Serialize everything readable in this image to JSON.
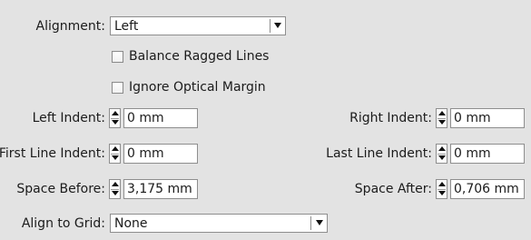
{
  "alignment": {
    "label": "Alignment:",
    "value": "Left"
  },
  "checkboxes": {
    "balance_ragged_lines": {
      "label": "Balance Ragged Lines",
      "checked": false
    },
    "ignore_optical_margin": {
      "label": "Ignore Optical Margin",
      "checked": false
    }
  },
  "left_indent": {
    "label": "Left Indent:",
    "value": "0 mm"
  },
  "right_indent": {
    "label": "Right Indent:",
    "value": "0 mm"
  },
  "first_line_indent": {
    "label": "First Line Indent:",
    "value": "0 mm"
  },
  "last_line_indent": {
    "label": "Last Line Indent:",
    "value": "0 mm"
  },
  "space_before": {
    "label": "Space Before:",
    "value": "3,175 mm"
  },
  "space_after": {
    "label": "Space After:",
    "value": "0,706 mm"
  },
  "align_to_grid": {
    "label": "Align to Grid:",
    "value": "None"
  }
}
